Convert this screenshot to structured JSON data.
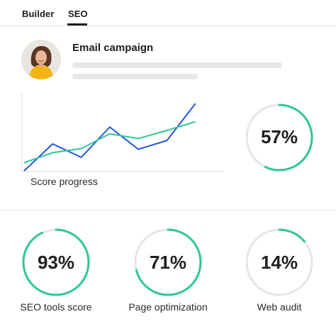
{
  "tabs": [
    {
      "label": "Builder",
      "active": false
    },
    {
      "label": "SEO",
      "active": true
    }
  ],
  "campaign": {
    "title": "Email campaign"
  },
  "chart_data": {
    "type": "line",
    "caption": "Score progress",
    "x": [
      0,
      1,
      2,
      3,
      4,
      5,
      6,
      7
    ],
    "ylim": [
      0,
      100
    ],
    "series": [
      {
        "color": "#2457d6",
        "values": [
          0,
          40,
          20,
          65,
          32,
          45,
          100,
          null
        ]
      },
      {
        "color": "#2fc69a",
        "values": [
          12,
          27,
          33,
          55,
          48,
          60,
          73,
          null
        ]
      }
    ]
  },
  "main_gauge": {
    "value": 57,
    "label": "57%",
    "color": "#2fc69a",
    "track": "#e6e6e6"
  },
  "metrics": [
    {
      "value": 93,
      "label": "93%",
      "name": "SEO tools score"
    },
    {
      "value": 71,
      "label": "71%",
      "name": "Page optimization"
    },
    {
      "value": 14,
      "label": "14%",
      "name": "Web audit"
    }
  ],
  "colors": {
    "accent": "#2fc69a",
    "line_blue": "#2457d6",
    "track": "#e6e6e6"
  }
}
